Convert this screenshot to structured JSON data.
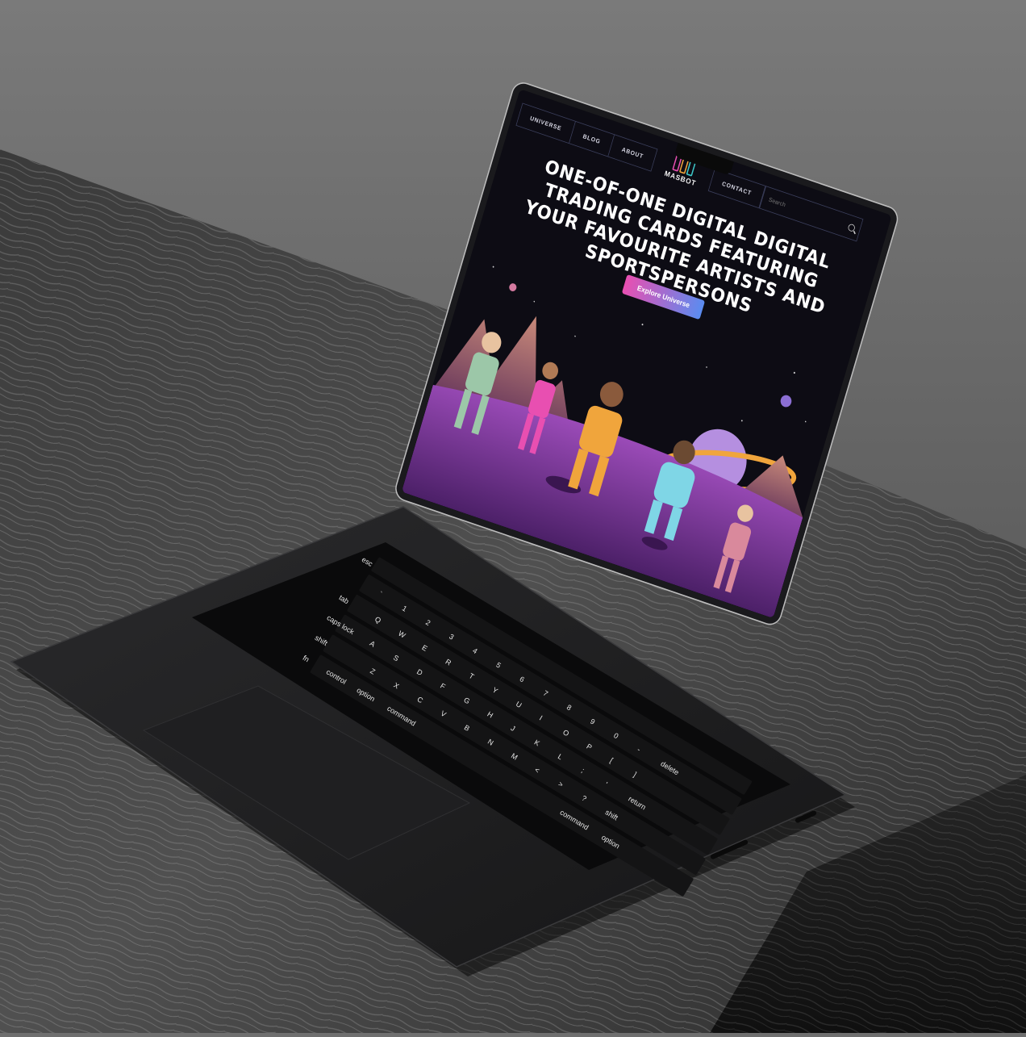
{
  "site": {
    "nav": {
      "universe": "UNIVERSE",
      "blog": "BLOG",
      "about": "ABOUT",
      "contact": "CONTACT"
    },
    "logo": "MASBOT",
    "search_placeholder": "Search",
    "hero_title": "ONE-OF-ONE DIGITAL DIGITAL TRADING CARDS FEATURING YOUR FAVOURITE ARTISTS AND SPORTSPERSONS",
    "cta": "Explore Universe",
    "colors": {
      "bg": "#0d0c14",
      "accent_pink": "#e84fb1",
      "accent_blue": "#5a8cf0",
      "ground": "#7a3f9c"
    }
  },
  "keyboard": {
    "esc": "esc",
    "tab": "tab",
    "caps": "caps lock",
    "shift_left": "shift",
    "fn": "fn",
    "control": "control",
    "option_left": "option",
    "command_left": "command",
    "command_right": "command",
    "option_right": "option",
    "delete": "delete",
    "return": "return",
    "shift_right": "shift",
    "row_num": [
      "`",
      "1",
      "2",
      "3",
      "4",
      "5",
      "6",
      "7",
      "8",
      "9",
      "0",
      "-",
      "="
    ],
    "row_q": [
      "Q",
      "W",
      "E",
      "R",
      "T",
      "Y",
      "U",
      "I",
      "O",
      "P",
      "[",
      "]"
    ],
    "row_a": [
      "A",
      "S",
      "D",
      "F",
      "G",
      "H",
      "J",
      "K",
      "L",
      ";",
      "'"
    ],
    "row_z": [
      "Z",
      "X",
      "C",
      "V",
      "B",
      "N",
      "M",
      "<",
      ">",
      "?"
    ]
  }
}
